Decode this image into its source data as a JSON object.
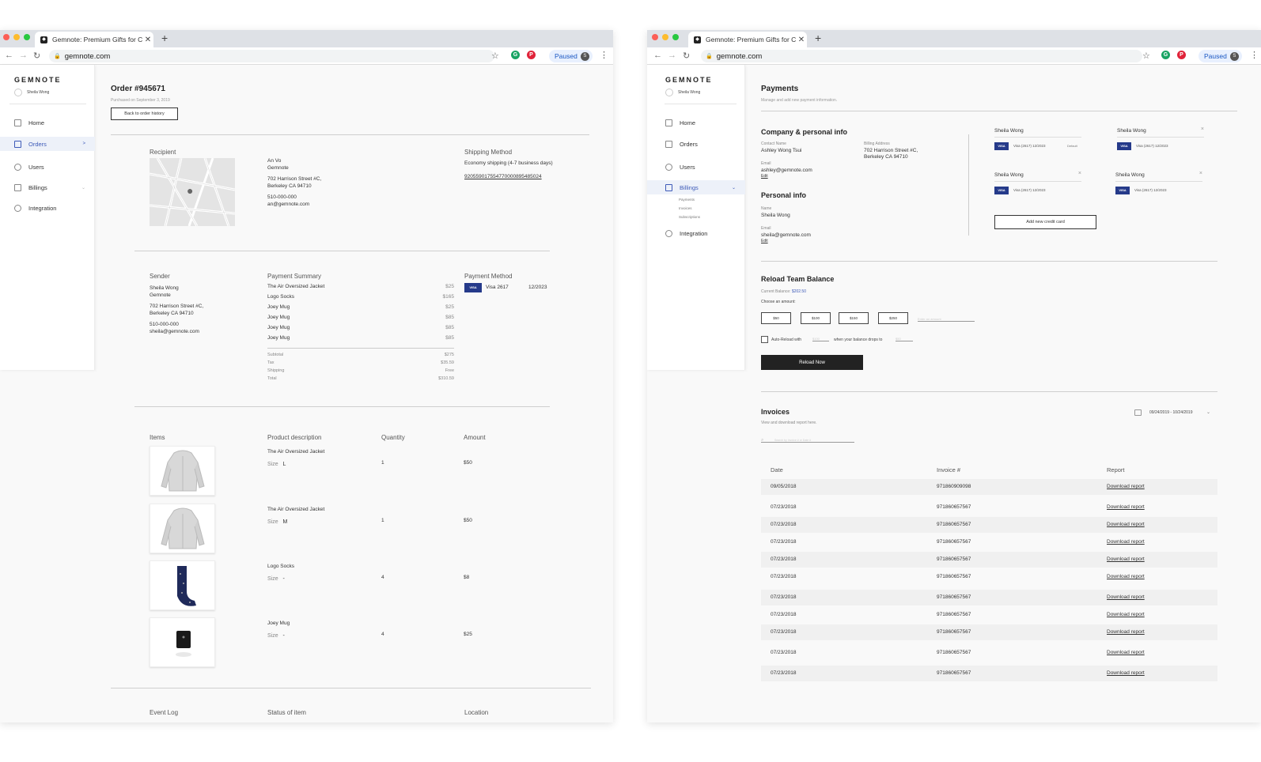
{
  "browser": {
    "tab_title": "Gemnote: Premium Gifts for Co",
    "url": "gemnote.com",
    "paused_label": "Paused",
    "profile_initial": "S"
  },
  "sidebar": {
    "brand": "GEMNOTE",
    "user_name": "Sheila Wong",
    "items": {
      "home": "Home",
      "orders": "Orders",
      "users": "Users",
      "billings": "Billings",
      "integration": "Integration"
    },
    "billing_sub": [
      "Payments",
      "Invoices",
      "Subscriptions"
    ]
  },
  "order": {
    "title": "Order #945671",
    "purchased": "Purchased on September 3, 2019",
    "back_button": "Back to order history",
    "recipient_heading": "Recipient",
    "recipient": {
      "name": "An Vo",
      "company": "Gemnote",
      "address1": "702 Harrison Street #C,",
      "address2": "Berkeley CA 94710",
      "phone": "510-000-000",
      "email": "an@gemnote.com"
    },
    "shipping_heading": "Shipping Method",
    "shipping_method": "Economy shipping (4-7 business days)",
    "tracking": "920559017554770000895485024",
    "sender_heading": "Sender",
    "sender": {
      "name": "Sheila Wong",
      "company": "Gemnote",
      "address1": "702 Harrison Street #C,",
      "address2": "Berkeley CA 94710",
      "phone": "510-000-000",
      "email": "sheila@gemnote.com"
    },
    "payment_summary_heading": "Payment Summary",
    "payment_lines": [
      {
        "name": "The Air Oversized Jacket",
        "price": "$25"
      },
      {
        "name": "Logo Socks",
        "price": "$165"
      },
      {
        "name": "Joey Mug",
        "price": "$25"
      },
      {
        "name": "Joey Mug",
        "price": "$85"
      },
      {
        "name": "Joey Mug",
        "price": "$85"
      },
      {
        "name": "Joey Mug",
        "price": "$85"
      }
    ],
    "totals": [
      {
        "label": "Subtotal",
        "value": "$275"
      },
      {
        "label": "Tax",
        "value": "$35.59"
      },
      {
        "label": "Shipping",
        "value": "Free"
      },
      {
        "label": "Total",
        "value": "$310.59"
      }
    ],
    "payment_method_heading": "Payment Method",
    "card_brand": "VISA",
    "card_label": "Visa 2617",
    "card_expiry": "12/2023",
    "items_headers": [
      "Items",
      "Product description",
      "Quantity",
      "Amount"
    ],
    "size_label": "Size",
    "items": [
      {
        "name": "The Air Oversized Jacket",
        "size": "L",
        "qty": "1",
        "amount": "$50",
        "icon": "jacket-image"
      },
      {
        "name": "The Air Oversized Jacket",
        "size": "M",
        "qty": "1",
        "amount": "$50",
        "icon": "jacket-image"
      },
      {
        "name": "Logo Socks",
        "size": "-",
        "qty": "4",
        "amount": "$8",
        "icon": "socks-image"
      },
      {
        "name": "Joey Mug",
        "size": "-",
        "qty": "4",
        "amount": "$25",
        "icon": "mug-image"
      }
    ],
    "event_headers": [
      "Event Log",
      "Status of item",
      "Location"
    ]
  },
  "payments": {
    "title": "Payments",
    "subtitle": "Manage and add new payment information.",
    "company_heading": "Company & personal info",
    "contact_label": "Contact Name",
    "contact_value": "Ashley Wong Tsui",
    "billing_label": "Billing Address",
    "billing_address1": "702 Harrison Street #C,",
    "billing_address2": "Berkeley CA 94710",
    "email_label": "Email",
    "company_email": "ashley@gemnote.com",
    "edit_label": "Edit",
    "personal_heading": "Personal info",
    "name_label": "Name",
    "personal_name": "Sheila Wong",
    "personal_email": "sheila@gemnote.com",
    "cards": [
      {
        "holder": "Sheila Wong",
        "brand": "VISA",
        "label": "Visa (2617) 12/2023",
        "tag": "Default"
      },
      {
        "holder": "Sheila Wong",
        "brand": "VISA",
        "label": "Visa (2617) 12/2023",
        "tag": "×"
      },
      {
        "holder": "Sheila Wong",
        "brand": "VISA",
        "label": "Visa (2617) 12/2023",
        "tag": "×"
      },
      {
        "holder": "Sheila Wong",
        "brand": "VISA",
        "label": "Visa (2617) 12/2023",
        "tag": "×"
      }
    ],
    "add_card_button": "Add new credit card",
    "reload_heading": "Reload Team Balance",
    "current_balance_label": "Current Balance:",
    "current_balance_value": "$202.50",
    "choose_amount_label": "Choose an amount:",
    "amounts": [
      "$50",
      "$100",
      "$150",
      "$250"
    ],
    "amount_placeholder": "Enter an amount",
    "auto_reload_label": "Auto-Reload with",
    "auto_reload_amount_placeholder": "$100",
    "drops_label": "when your balance drops to",
    "drops_placeholder": "$50",
    "reload_button": "Reload Now"
  },
  "invoices": {
    "title": "Invoices",
    "subtitle": "View and download report here.",
    "date_range": "09/24/2019 - 10/24/2019",
    "search_placeholder": "Search by Invoice # or Date #",
    "headers": [
      "Date",
      "Invoice #",
      "Report"
    ],
    "rows": [
      {
        "date": "09/05/2018",
        "invoice": "971860909098",
        "report": "Download report"
      },
      {
        "date": "07/23/2018",
        "invoice": "971860657567",
        "report": "Download report"
      },
      {
        "date": "07/23/2018",
        "invoice": "971860657567",
        "report": "Download report"
      },
      {
        "date": "07/23/2018",
        "invoice": "971860657567",
        "report": "Download report"
      },
      {
        "date": "07/23/2018",
        "invoice": "971860657567",
        "report": "Download report"
      },
      {
        "date": "07/23/2018",
        "invoice": "971860657567",
        "report": "Download report"
      },
      {
        "date": "07/23/2018",
        "invoice": "971860657567",
        "report": "Download report"
      },
      {
        "date": "07/23/2018",
        "invoice": "971860657567",
        "report": "Download report"
      },
      {
        "date": "07/23/2018",
        "invoice": "971860657567",
        "report": "Download report"
      },
      {
        "date": "07/23/2018",
        "invoice": "971860657567",
        "report": "Download report"
      },
      {
        "date": "07/23/2018",
        "invoice": "971860657567",
        "report": "Download report"
      }
    ]
  },
  "colors": {
    "accent": "#3d5ab8",
    "visa": "#253a8a",
    "dark_button": "#222222"
  }
}
